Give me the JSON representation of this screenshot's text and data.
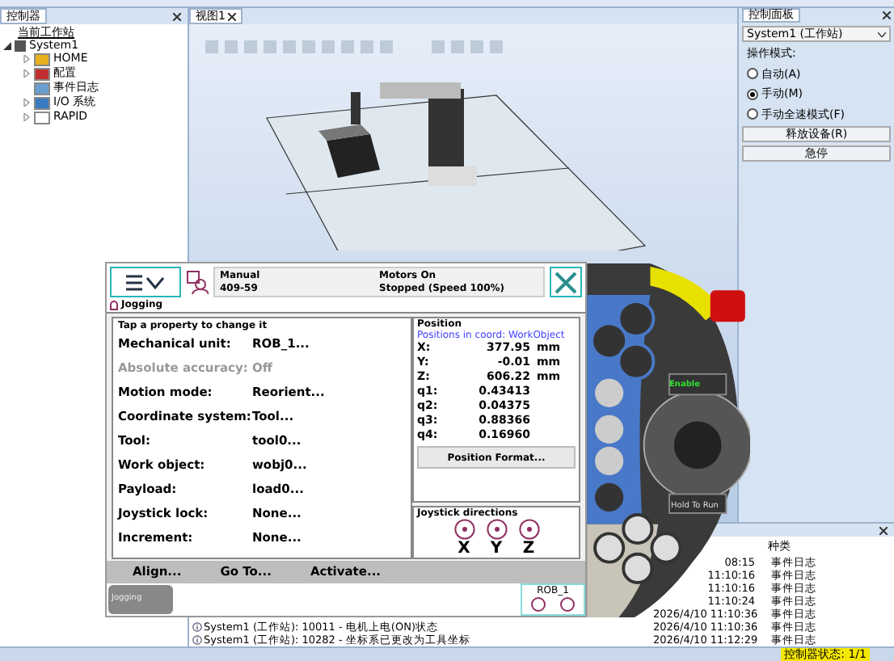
{
  "controller_panel": {
    "tab": "控制器",
    "tree": [
      {
        "label": "当前工作站"
      },
      {
        "label": "System1",
        "expanded": true,
        "children": [
          {
            "label": "HOME",
            "kind": "folder",
            "expanded": false
          },
          {
            "label": "配置",
            "kind": "config",
            "expanded": false
          },
          {
            "label": "事件日志",
            "kind": "log"
          },
          {
            "label": "I/O 系统",
            "kind": "io",
            "expanded": false
          },
          {
            "label": "RAPID",
            "kind": "rapid",
            "expanded": false
          }
        ]
      }
    ]
  },
  "view": {
    "tab": "视图1"
  },
  "control_panel": {
    "tab": "控制面板",
    "system": "System1 (工作站)",
    "mode_label": "操作模式:",
    "modes": [
      {
        "label": "自动(A)",
        "selected": false
      },
      {
        "label": "手动(M)",
        "selected": true
      },
      {
        "label": "手动全速模式(F)",
        "selected": false
      }
    ],
    "buttons": [
      "释放设备(R)",
      "急停"
    ]
  },
  "event_log": {
    "kind_header": "种类",
    "rows": [
      {
        "time": "08:15",
        "kind": "事件日志"
      },
      {
        "time": "11:10:16",
        "kind": "事件日志"
      },
      {
        "time": "11:10:16",
        "kind": "事件日志"
      },
      {
        "time": "11:10:24",
        "kind": "事件日志"
      },
      {
        "time": "2026/4/10 11:10:36",
        "kind": "事件日志"
      },
      {
        "message": "System1 (工作站): 10011 - 电机上电(ON)状态",
        "time": "2026/4/10 11:10:36",
        "kind": "事件日志"
      },
      {
        "message": "System1 (工作站): 10282 - 坐标系已更改为工具坐标",
        "time": "2026/4/10 11:12:29",
        "kind": "事件日志"
      }
    ]
  },
  "status_bar": {
    "controller_status": "控制器状态: 1/1"
  },
  "pendant": {
    "status": {
      "mode": "Manual",
      "system": "409-59",
      "motors": "Motors On",
      "state": "Stopped (Speed 100%)"
    },
    "title": "Jogging",
    "properties_header": "Tap a property to change it",
    "properties": [
      {
        "label": "Mechanical unit:",
        "value": "ROB_1...",
        "disabled": false
      },
      {
        "label": "Absolute accuracy:",
        "value": "Off",
        "disabled": true
      },
      {
        "label": "Motion mode:",
        "value": "Reorient...",
        "disabled": false
      },
      {
        "label": "Coordinate system:",
        "value": "Tool...",
        "disabled": false
      },
      {
        "label": "Tool:",
        "value": "tool0...",
        "disabled": false
      },
      {
        "label": "Work object:",
        "value": "wobj0...",
        "disabled": false
      },
      {
        "label": "Payload:",
        "value": "load0...",
        "disabled": false
      },
      {
        "label": "Joystick lock:",
        "value": "None...",
        "disabled": false
      },
      {
        "label": "Increment:",
        "value": "None...",
        "disabled": false
      }
    ],
    "position": {
      "header": "Position",
      "coord_note": "Positions in coord: WorkObject",
      "values": [
        {
          "label": "X:",
          "value": "377.95",
          "unit": "mm"
        },
        {
          "label": "Y:",
          "value": "-0.01",
          "unit": "mm"
        },
        {
          "label": "Z:",
          "value": "606.22",
          "unit": "mm"
        },
        {
          "label": "q1:",
          "value": "0.43413"
        },
        {
          "label": "q2:",
          "value": "0.04375"
        },
        {
          "label": "q3:",
          "value": "0.88366"
        },
        {
          "label": "q4:",
          "value": "0.16960"
        }
      ],
      "format_button": "Position Format..."
    },
    "joystick": {
      "header": "Joystick directions",
      "axes": [
        "X",
        "Y",
        "Z"
      ]
    },
    "actions": [
      "Align...",
      "Go To...",
      "Activate..."
    ],
    "taskbar": {
      "tab": "Jogging",
      "unit": "ROB_1"
    },
    "device": {
      "enable": "Enable",
      "hold": "Hold To Run"
    }
  }
}
